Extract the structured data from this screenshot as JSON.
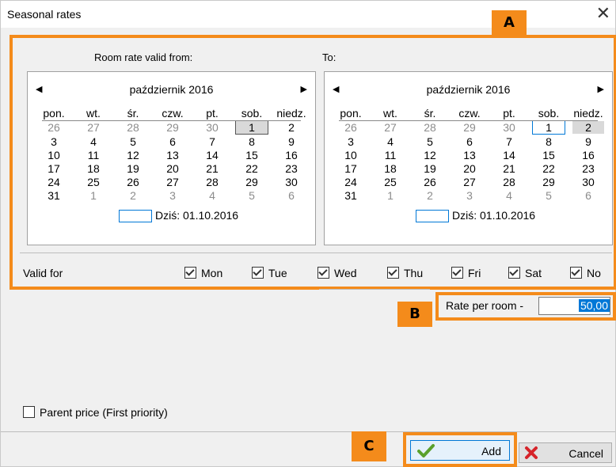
{
  "window": {
    "title": "Seasonal rates",
    "close_glyph": "✕"
  },
  "markers": {
    "a": "A",
    "b": "B",
    "c": "C"
  },
  "range": {
    "from_label": "Room rate valid from:",
    "to_label": "To:",
    "from_calendar": {
      "month": "październik 2016",
      "weekdays": [
        "pon.",
        "wt.",
        "śr.",
        "czw.",
        "pt.",
        "sob.",
        "niedz."
      ],
      "rows": [
        [
          "26",
          "27",
          "28",
          "29",
          "30",
          "1",
          "2"
        ],
        [
          "3",
          "4",
          "5",
          "6",
          "7",
          "8",
          "9"
        ],
        [
          "10",
          "11",
          "12",
          "13",
          "14",
          "15",
          "16"
        ],
        [
          "17",
          "18",
          "19",
          "20",
          "21",
          "22",
          "23"
        ],
        [
          "24",
          "25",
          "26",
          "27",
          "28",
          "29",
          "30"
        ],
        [
          "31",
          "1",
          "2",
          "3",
          "4",
          "5",
          "6"
        ]
      ],
      "today_label": "Dziś: 01.10.2016"
    },
    "to_calendar": {
      "month": "październik 2016",
      "weekdays": [
        "pon.",
        "wt.",
        "śr.",
        "czw.",
        "pt.",
        "sob.",
        "niedz."
      ],
      "rows": [
        [
          "26",
          "27",
          "28",
          "29",
          "30",
          "1",
          "2"
        ],
        [
          "3",
          "4",
          "5",
          "6",
          "7",
          "8",
          "9"
        ],
        [
          "10",
          "11",
          "12",
          "13",
          "14",
          "15",
          "16"
        ],
        [
          "17",
          "18",
          "19",
          "20",
          "21",
          "22",
          "23"
        ],
        [
          "24",
          "25",
          "26",
          "27",
          "28",
          "29",
          "30"
        ],
        [
          "31",
          "1",
          "2",
          "3",
          "4",
          "5",
          "6"
        ]
      ],
      "today_label": "Dziś: 01.10.2016"
    }
  },
  "valid_for": {
    "label": "Valid for",
    "days": [
      {
        "label": "Mon",
        "checked": true
      },
      {
        "label": "Tue",
        "checked": true
      },
      {
        "label": "Wed",
        "checked": true
      },
      {
        "label": "Thu",
        "checked": true
      },
      {
        "label": "Fri",
        "checked": true
      },
      {
        "label": "Sat",
        "checked": true
      },
      {
        "label": "No",
        "checked": true
      }
    ]
  },
  "rate": {
    "label": "Rate per room -",
    "value": "50,00"
  },
  "parent_price": {
    "label": "Parent price (First priority)",
    "checked": false
  },
  "buttons": {
    "add": "Add",
    "cancel": "Cancel"
  },
  "colors": {
    "highlight": "#f48b1b",
    "selection": "#0078d7"
  }
}
